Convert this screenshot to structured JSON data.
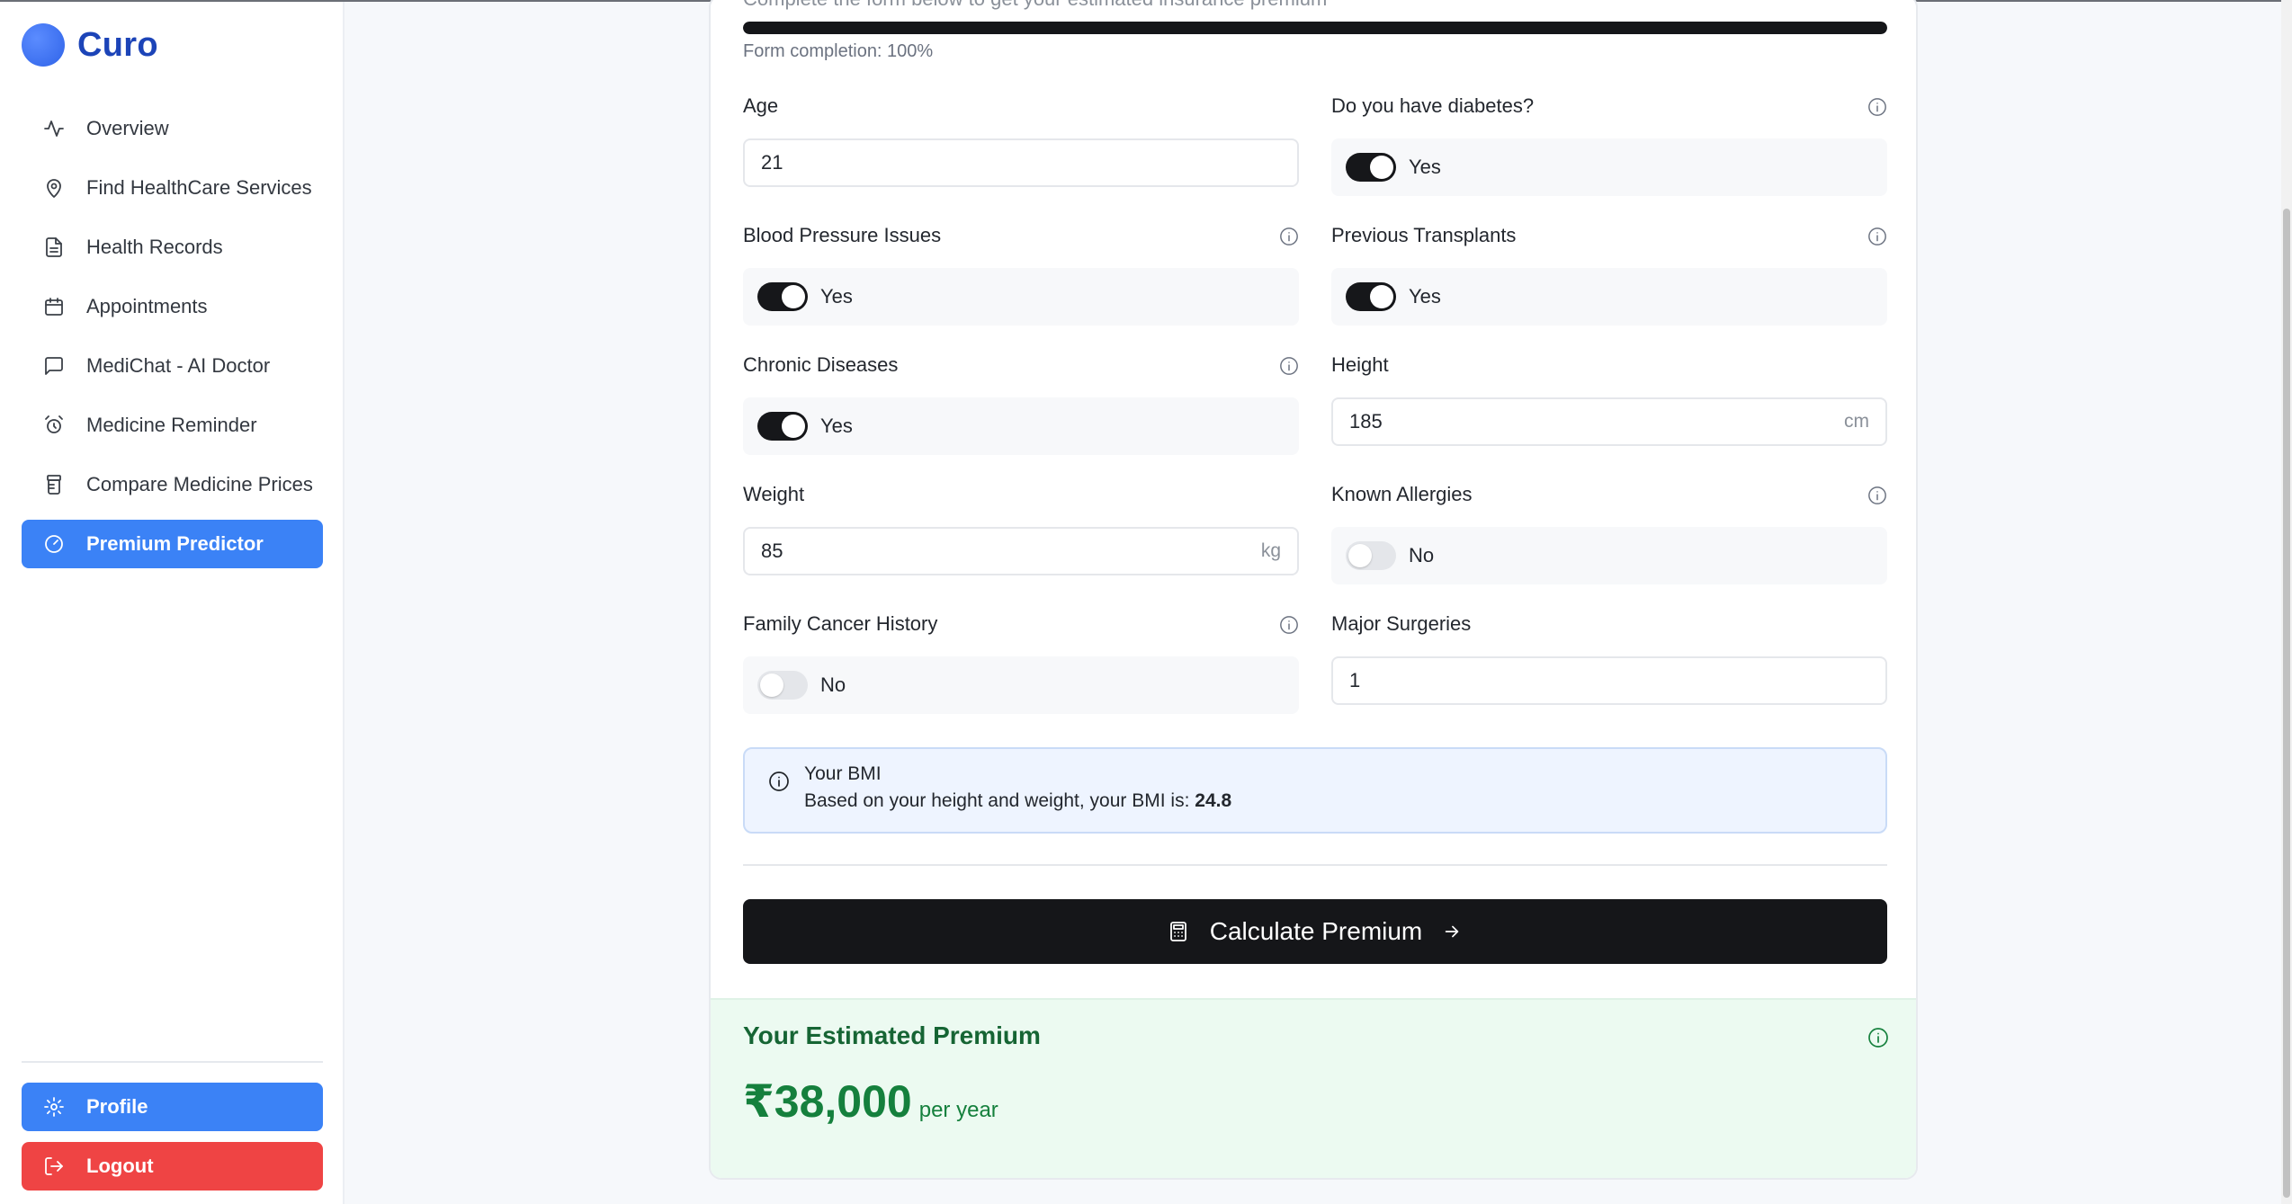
{
  "app": {
    "name": "Curo"
  },
  "sidebar": {
    "items": [
      {
        "label": "Overview",
        "icon": "activity-icon"
      },
      {
        "label": "Find HealthCare Services",
        "icon": "map-pin-icon"
      },
      {
        "label": "Health Records",
        "icon": "file-text-icon"
      },
      {
        "label": "Appointments",
        "icon": "calendar-icon"
      },
      {
        "label": "MediChat - AI Doctor",
        "icon": "message-square-icon"
      },
      {
        "label": "Medicine Reminder",
        "icon": "alarm-clock-icon"
      },
      {
        "label": "Compare Medicine Prices",
        "icon": "pill-bottle-icon"
      },
      {
        "label": "Premium Predictor",
        "icon": "gauge-icon",
        "active": true
      }
    ],
    "profile_label": "Profile",
    "logout_label": "Logout"
  },
  "form": {
    "subtitle": "Complete the form below to get your estimated insurance premium",
    "progress_percent": 100,
    "progress_text": "Form completion: 100%",
    "fields": {
      "age": {
        "label": "Age",
        "value": "21"
      },
      "diabetes": {
        "label": "Do you have diabetes?",
        "state": "Yes",
        "on": true
      },
      "blood_pressure": {
        "label": "Blood Pressure Issues",
        "state": "Yes",
        "on": true
      },
      "transplants": {
        "label": "Previous Transplants",
        "state": "Yes",
        "on": true
      },
      "chronic": {
        "label": "Chronic Diseases",
        "state": "Yes",
        "on": true
      },
      "height": {
        "label": "Height",
        "value": "185",
        "unit": "cm"
      },
      "weight": {
        "label": "Weight",
        "value": "85",
        "unit": "kg"
      },
      "allergies": {
        "label": "Known Allergies",
        "state": "No",
        "on": false
      },
      "cancer_history": {
        "label": "Family Cancer History",
        "state": "No",
        "on": false
      },
      "surgeries": {
        "label": "Major Surgeries",
        "value": "1"
      }
    },
    "bmi": {
      "title": "Your BMI",
      "text": "Based on your height and weight, your BMI is:",
      "value": "24.8"
    },
    "calculate_label": "Calculate Premium"
  },
  "result": {
    "title": "Your Estimated Premium",
    "amount": "₹38,000",
    "period": "per year"
  },
  "colors": {
    "brand": "#1c44b8",
    "accent": "#3b82f6",
    "danger": "#ef4444",
    "success": "#15803d"
  }
}
